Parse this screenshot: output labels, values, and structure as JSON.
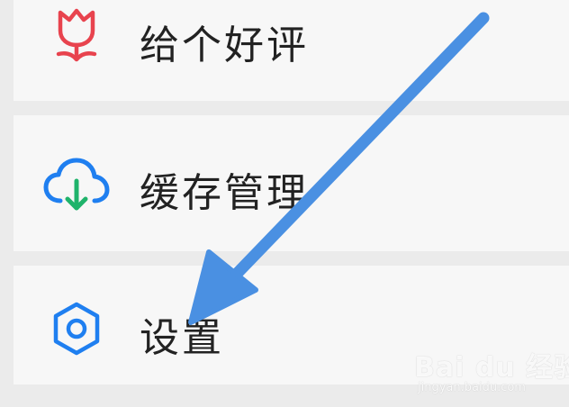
{
  "menu": {
    "items": [
      {
        "label": "给个好评",
        "icon": "tulip-icon",
        "icon_color": "#e8434e"
      },
      {
        "label": "缓存管理",
        "icon": "cloud-download-icon",
        "icon_color": "#1f7ff0",
        "icon_accent": "#1fb36b"
      },
      {
        "label": "设置",
        "icon": "gear-icon",
        "icon_color": "#1f7ff0"
      }
    ]
  },
  "annotation": {
    "arrow_color": "#4a90e2",
    "target": "settings"
  },
  "watermark": {
    "logo_text": "Bai du 经验",
    "sub_text": "jingyan.baidu.com"
  }
}
